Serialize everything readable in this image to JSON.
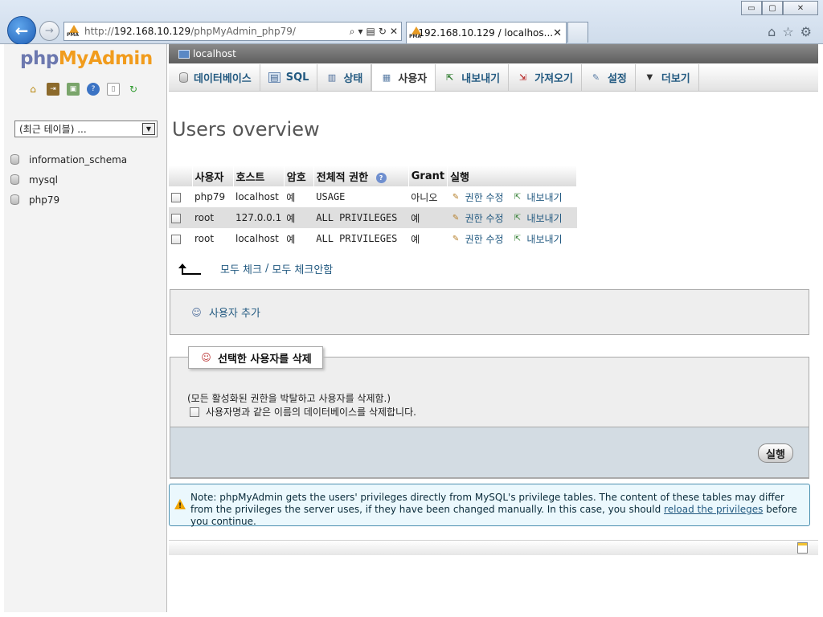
{
  "browser": {
    "address": {
      "proto": "http://",
      "host": "192.168.10.129",
      "path": "/phpMyAdmin_php79/"
    },
    "tab_title": "192.168.10.129 / localhos...",
    "favicon_text": "PMA",
    "window_buttons": {
      "minimize": "▭",
      "maximize": "▢",
      "close": "✕"
    }
  },
  "sidebar": {
    "logo": {
      "php": "php",
      "my": "My",
      "admin": "Admin"
    },
    "recent_label": "(최근 테이블) ...",
    "databases": [
      "information_schema",
      "mysql",
      "php79"
    ]
  },
  "server": {
    "name": "localhost"
  },
  "tabs": [
    {
      "label": "데이터베이스",
      "icon": "database-icon"
    },
    {
      "label": "SQL",
      "icon": "sql-icon"
    },
    {
      "label": "상태",
      "icon": "status-icon"
    },
    {
      "label": "사용자",
      "icon": "users-icon",
      "active": true
    },
    {
      "label": "내보내기",
      "icon": "export-icon"
    },
    {
      "label": "가져오기",
      "icon": "import-icon"
    },
    {
      "label": "설정",
      "icon": "settings-icon"
    },
    {
      "label": "더보기",
      "icon": "more-icon"
    }
  ],
  "page_title": "Users overview",
  "table": {
    "headers": {
      "user": "사용자",
      "host": "호스트",
      "password": "암호",
      "global_priv": "전체적 권한",
      "grant": "Grant",
      "action": "실행"
    },
    "rows": [
      {
        "user": "php79",
        "host": "localhost",
        "password": "예",
        "priv": "USAGE",
        "grant": "아니오",
        "edit": "권한 수정",
        "export": "내보내기"
      },
      {
        "user": "root",
        "host": "127.0.0.1",
        "password": "예",
        "priv": "ALL PRIVILEGES",
        "grant": "예",
        "edit": "권한 수정",
        "export": "내보내기"
      },
      {
        "user": "root",
        "host": "localhost",
        "password": "예",
        "priv": "ALL PRIVILEGES",
        "grant": "예",
        "edit": "권한 수정",
        "export": "내보내기"
      }
    ]
  },
  "check_all": {
    "check": "모두 체크",
    "separator": "/",
    "uncheck": "모두 체크안함"
  },
  "add_user": {
    "label": "사용자 추가"
  },
  "delete_section": {
    "legend": "선택한 사용자를 삭제",
    "note": "(모든 활성화된 권한을 박탈하고 사용자를 삭제함.)",
    "option": "사용자명과 같은 이름의 데이터베이스를 삭제합니다.",
    "go_label": "실행"
  },
  "notice": {
    "before": "Note: phpMyAdmin gets the users' privileges directly from MySQL's privilege tables. The content of these tables may differ from the privileges the server uses, if they have been changed manually. In this case, you should ",
    "link": "reload the privileges",
    "after": " before you continue."
  },
  "colors": {
    "link": "#235a81",
    "logo_orange": "#f19c1d",
    "logo_purple": "#6c78af",
    "footer_blue": "#d3dce3"
  }
}
